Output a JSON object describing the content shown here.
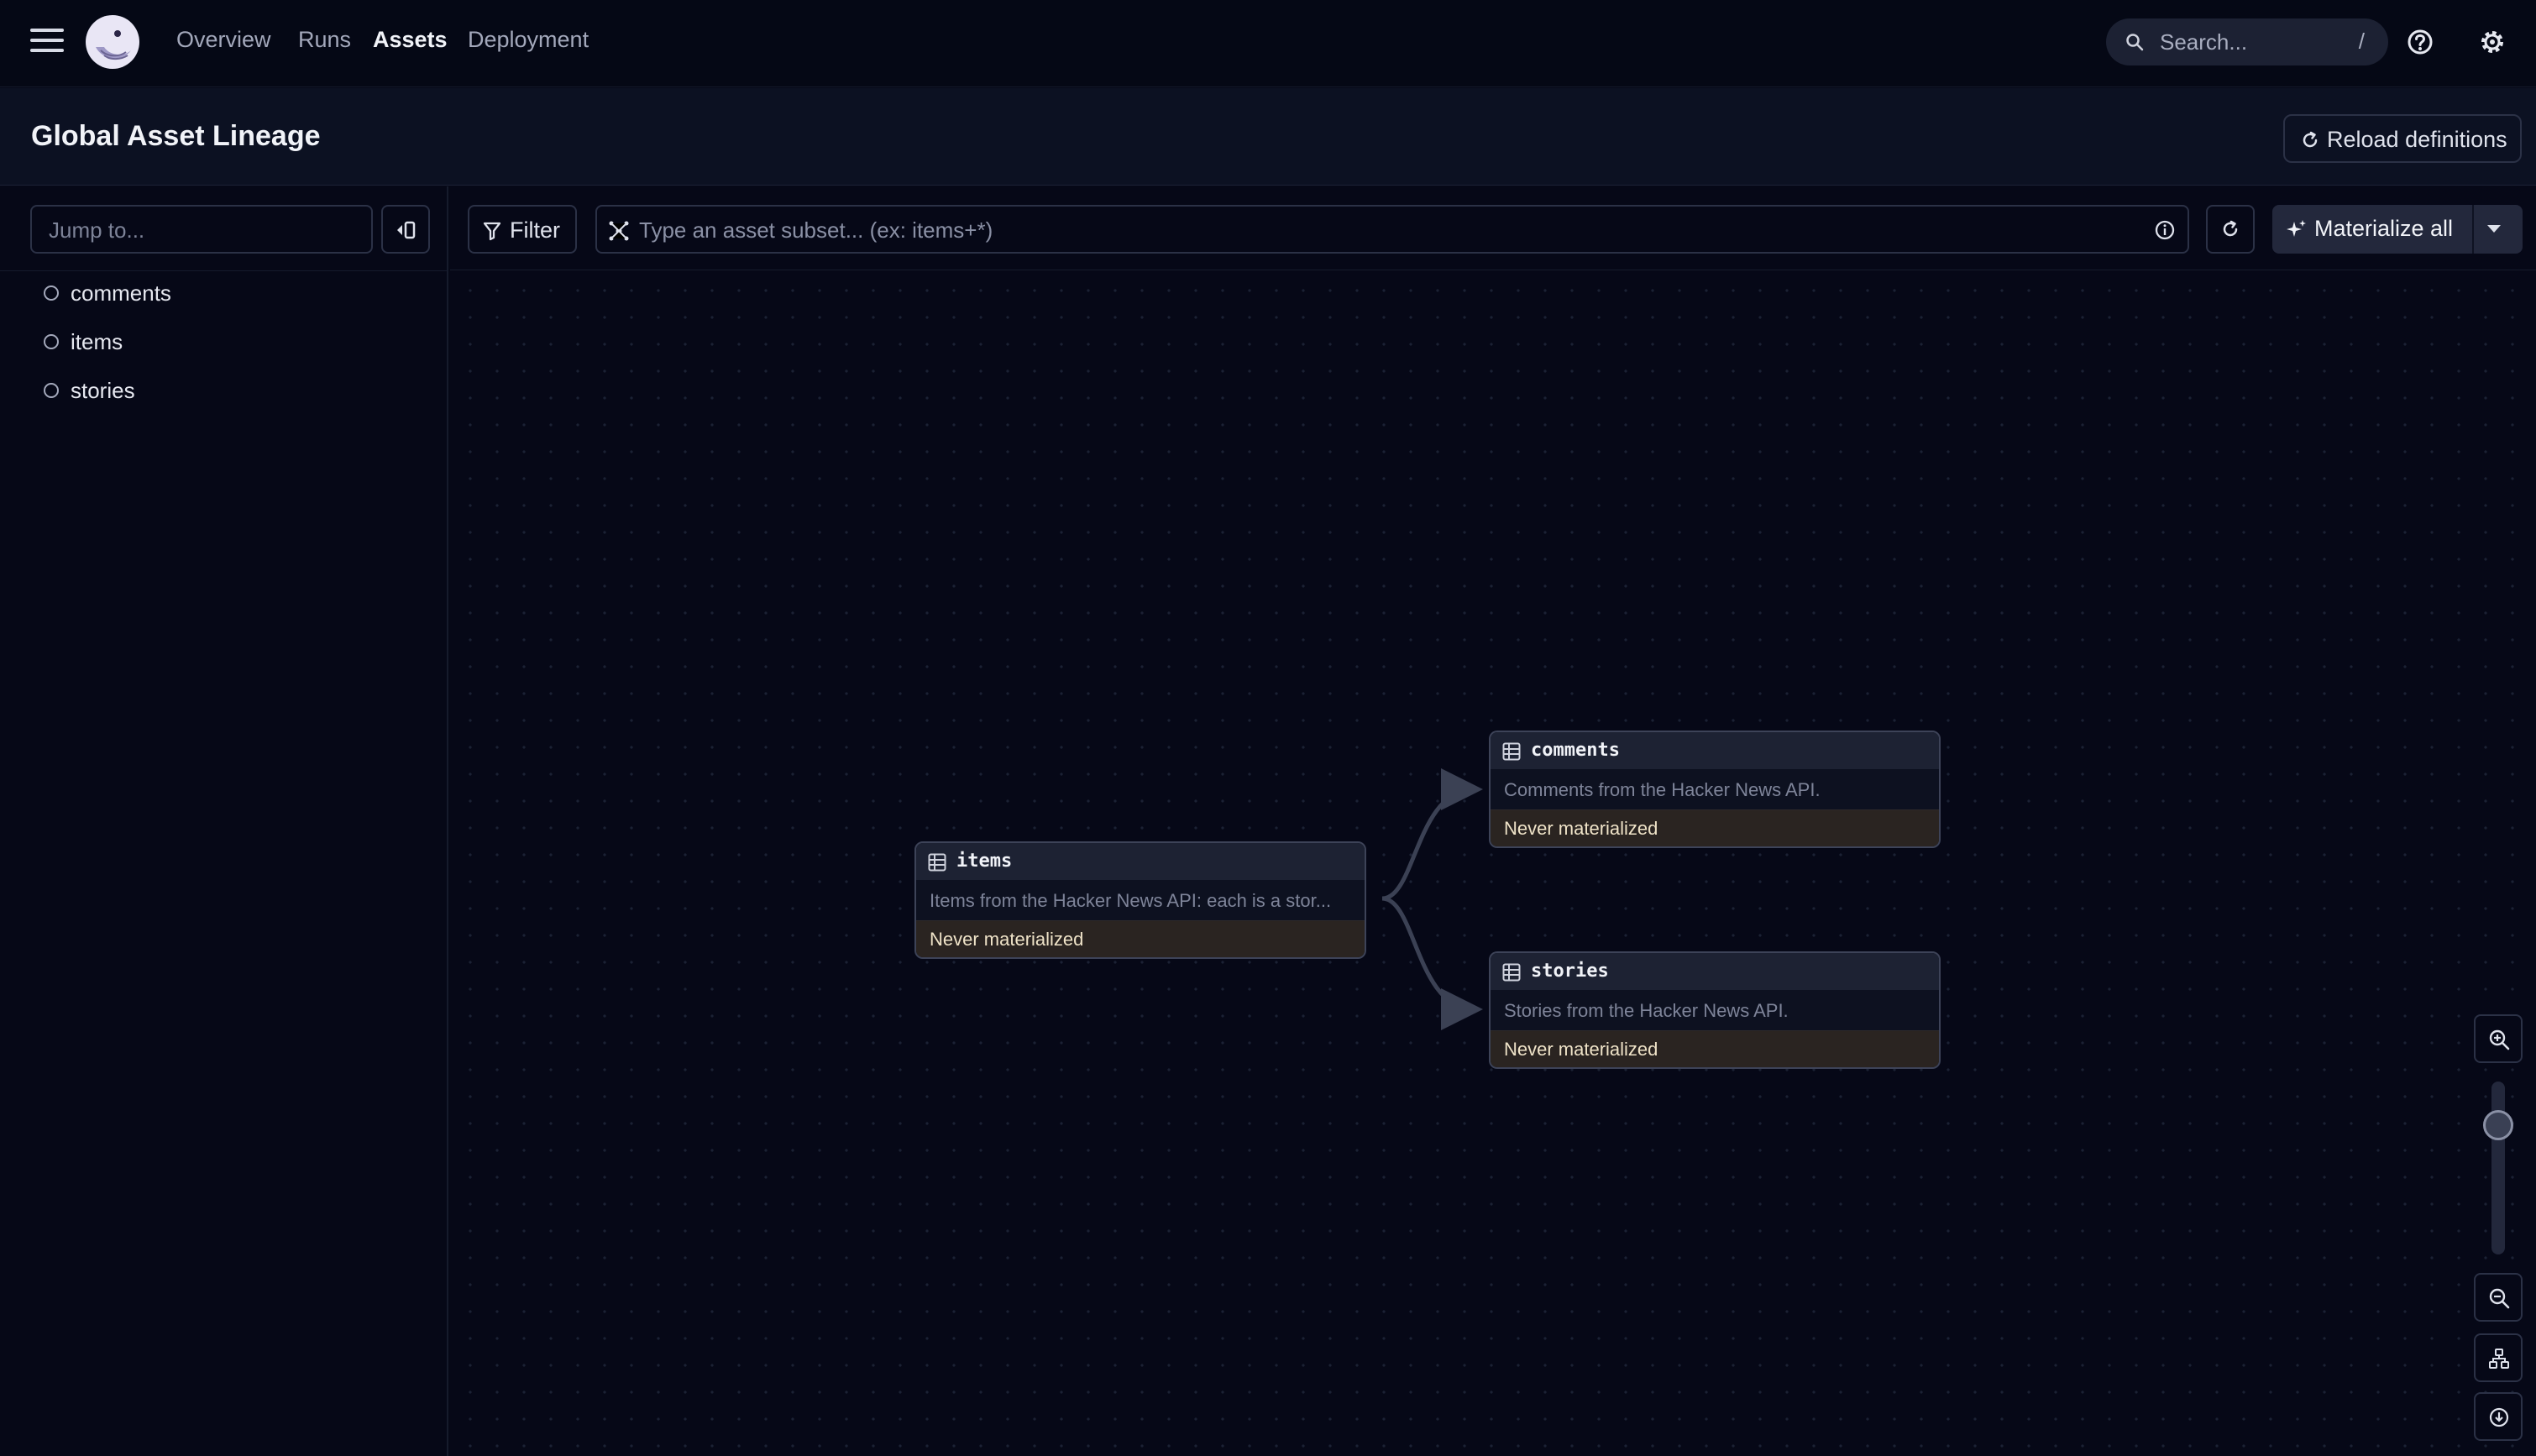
{
  "nav": {
    "links": [
      "Overview",
      "Runs",
      "Assets",
      "Deployment"
    ],
    "active": "Assets",
    "search_placeholder": "Search...",
    "search_shortcut": "/"
  },
  "header": {
    "title": "Global Asset Lineage",
    "reload_label": "Reload definitions"
  },
  "sidebar": {
    "jump_placeholder": "Jump to...",
    "items": [
      {
        "label": "comments"
      },
      {
        "label": "items"
      },
      {
        "label": "stories"
      }
    ]
  },
  "toolbar": {
    "filter_label": "Filter",
    "subset_placeholder": "Type an asset subset... (ex: items+*)",
    "materialize_label": "Materialize all"
  },
  "graph": {
    "nodes": {
      "items": {
        "name": "items",
        "description": "Items from the Hacker News API: each is a stor...",
        "status": "Never materialized"
      },
      "comments": {
        "name": "comments",
        "description": "Comments from the Hacker News API.",
        "status": "Never materialized"
      },
      "stories": {
        "name": "stories",
        "description": "Stories from the Hacker News API.",
        "status": "Never materialized"
      }
    },
    "edges": [
      {
        "from": "items",
        "to": "comments"
      },
      {
        "from": "items",
        "to": "stories"
      }
    ]
  },
  "zoom": {
    "level": 0.2
  },
  "colors": {
    "background": "#060817",
    "node_header": "#1d2233",
    "status_bg": "#2a2421",
    "status_text": "#efe3c8",
    "edge": "#3b4154"
  }
}
